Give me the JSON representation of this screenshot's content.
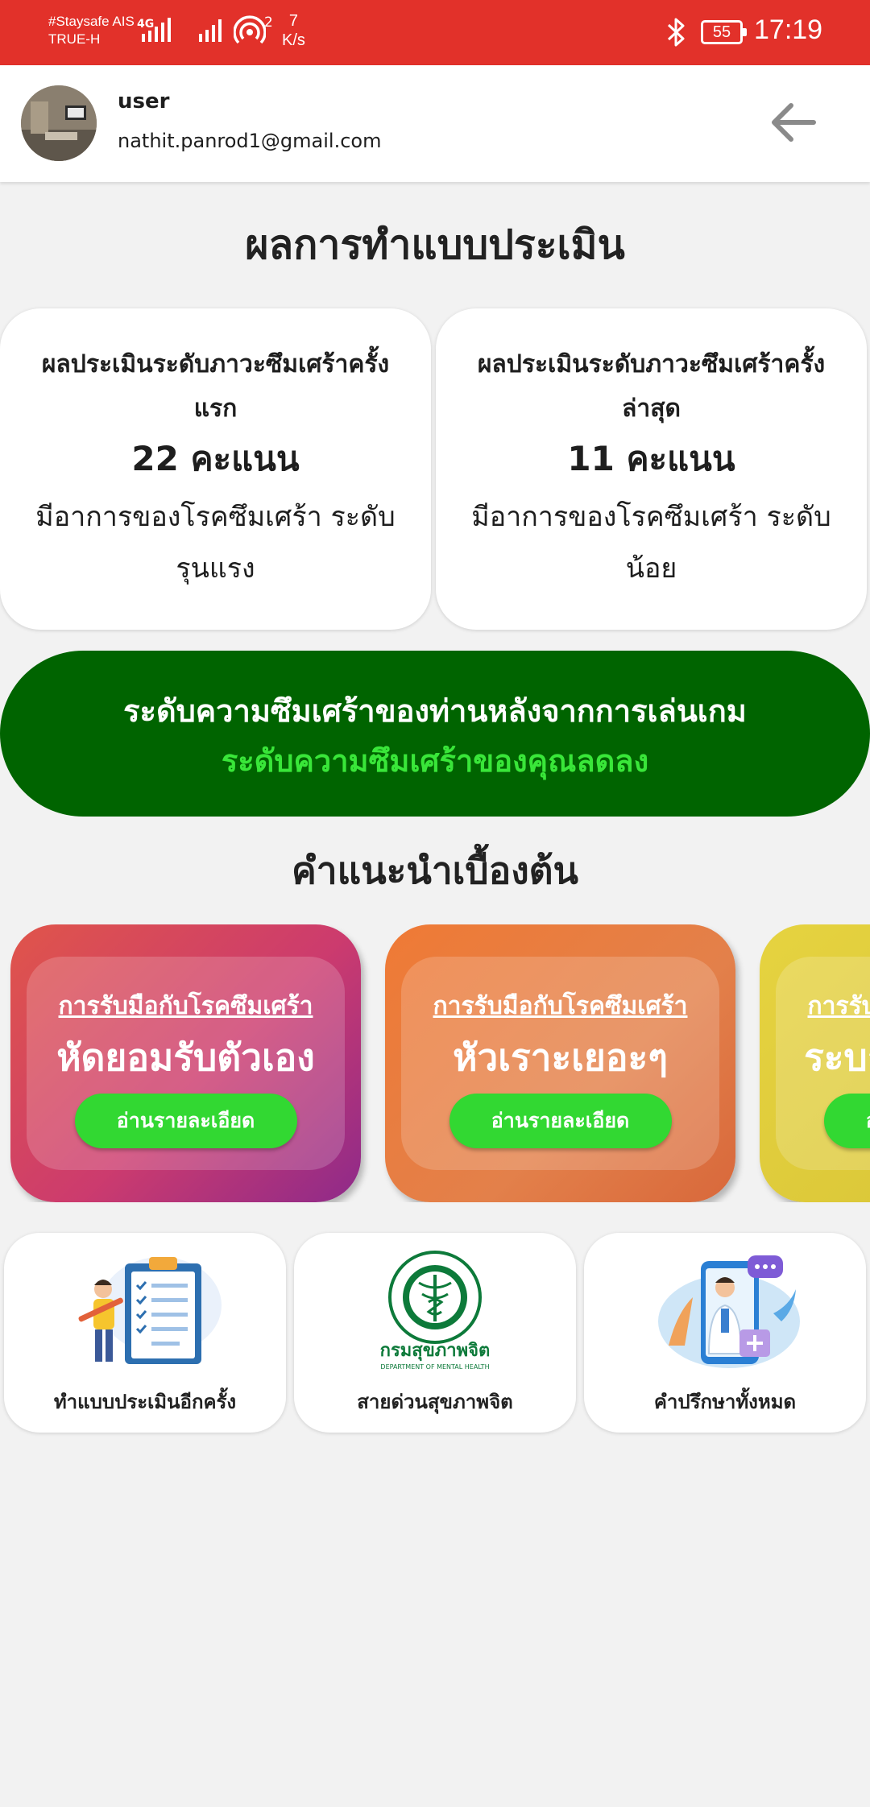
{
  "status_bar": {
    "carrier_line1": "#Staysafe AIS",
    "carrier_line2": "TRUE-H",
    "network": "4G",
    "hotspot_count": "2",
    "speed_value": "7",
    "speed_unit": "K/s",
    "battery": "55",
    "time": "17:19"
  },
  "header": {
    "username": "user",
    "email": "nathit.panrod1@gmail.com"
  },
  "page_title": "ผลการทำแบบประเมิน",
  "results": [
    {
      "title": "ผลประเมินระดับภาวะซึมเศร้าครั้งแรก",
      "score": "22 คะแนน",
      "description": "มีอาการของโรคซึมเศร้า ระดับรุนแรง"
    },
    {
      "title": "ผลประเมินระดับภาวะซึมเศร้าครั้งล่าสุด",
      "score": "11 คะแนน",
      "description": "มีอาการของโรคซึมเศร้า ระดับน้อย"
    }
  ],
  "banner": {
    "line1": "ระดับความซึมเศร้าของท่านหลังจากการเล่นเกม",
    "line2": "ระดับความซึมเศร้าของคุณลดลง"
  },
  "section_title": "คำแนะนำเบื้องต้น",
  "advice_cards": [
    {
      "subtitle": "การรับมือกับโรคซึมเศร้า",
      "title": "หัดยอมรับตัวเอง",
      "button": "อ่านรายละเอียด"
    },
    {
      "subtitle": "การรับมือกับโรคซึมเศร้า",
      "title": "หัวเราะเยอะๆ",
      "button": "อ่านรายละเอียด"
    },
    {
      "subtitle": "การรับมือกับโรคซึมเศร้า",
      "title": "ระบายความรู้สึก",
      "button": "อ่านรายละเอียด"
    }
  ],
  "tiles": [
    {
      "label": "ทำแบบประเมินอีกครั้ง",
      "icon": "clipboard-checklist-icon"
    },
    {
      "label": "สายด่วนสุขภาพจิต",
      "icon": "department-mental-health-logo",
      "logo_text": "กรมสุขภาพจิต",
      "logo_subtext": "DEPARTMENT OF MENTAL HEALTH"
    },
    {
      "label": "คำปรึกษาทั้งหมด",
      "icon": "doctor-phone-consult-icon"
    }
  ],
  "colors": {
    "status_bar": "#e2312a",
    "banner_bg": "#006400",
    "banner_highlight": "#39e639",
    "button_green": "#32d832"
  }
}
